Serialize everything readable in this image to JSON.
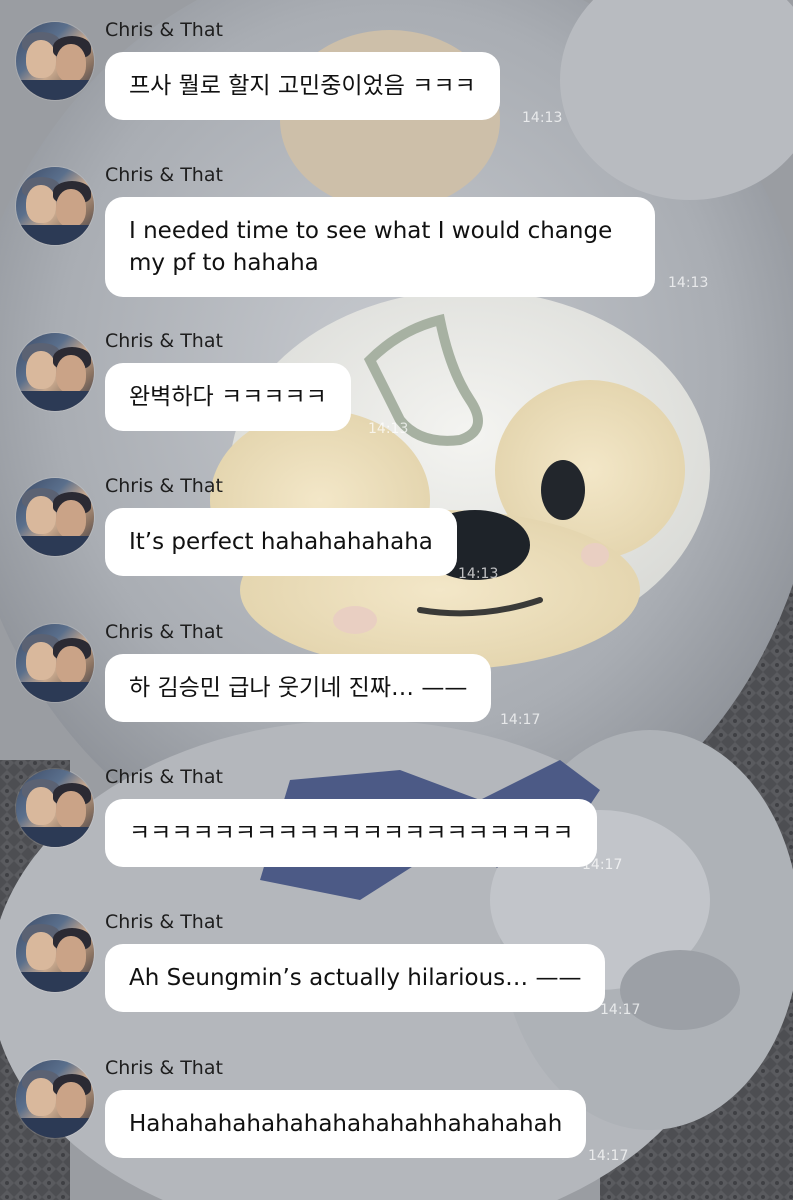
{
  "conversation": {
    "messages": [
      {
        "sender": "Chris & That",
        "text": "프사 뭘로 할지 고민중이었음 ㅋㅋㅋ",
        "time": "14:13"
      },
      {
        "sender": "Chris & That",
        "text": "I needed time to see what I would change my pf to hahaha",
        "time": "14:13"
      },
      {
        "sender": "Chris & That",
        "text": "완벽하다 ㅋㅋㅋㅋㅋ",
        "time": "14:13"
      },
      {
        "sender": "Chris & That",
        "text": "It’s perfect hahahahahaha",
        "time": "14:13"
      },
      {
        "sender": "Chris & That",
        "text": "하 김승민 급나 웃기네 진짜… ——",
        "time": "14:17"
      },
      {
        "sender": "Chris & That",
        "text": "ㅋㅋㅋㅋㅋㅋㅋㅋㅋㅋㅋㅋㅋㅋㅋㅋㅋㅋㅋㅋㅋ",
        "time": "14:17"
      },
      {
        "sender": "Chris & That",
        "text": "Ah Seungmin’s actually hilarious… ——",
        "time": "14:17"
      },
      {
        "sender": "Chris & That",
        "text": "Hahahahahahahahahahahhahahahah",
        "time": "14:17"
      }
    ]
  },
  "colors": {
    "bubble": "#ffffff",
    "sender_text": "#1e1e1e",
    "message_text": "#111111"
  }
}
